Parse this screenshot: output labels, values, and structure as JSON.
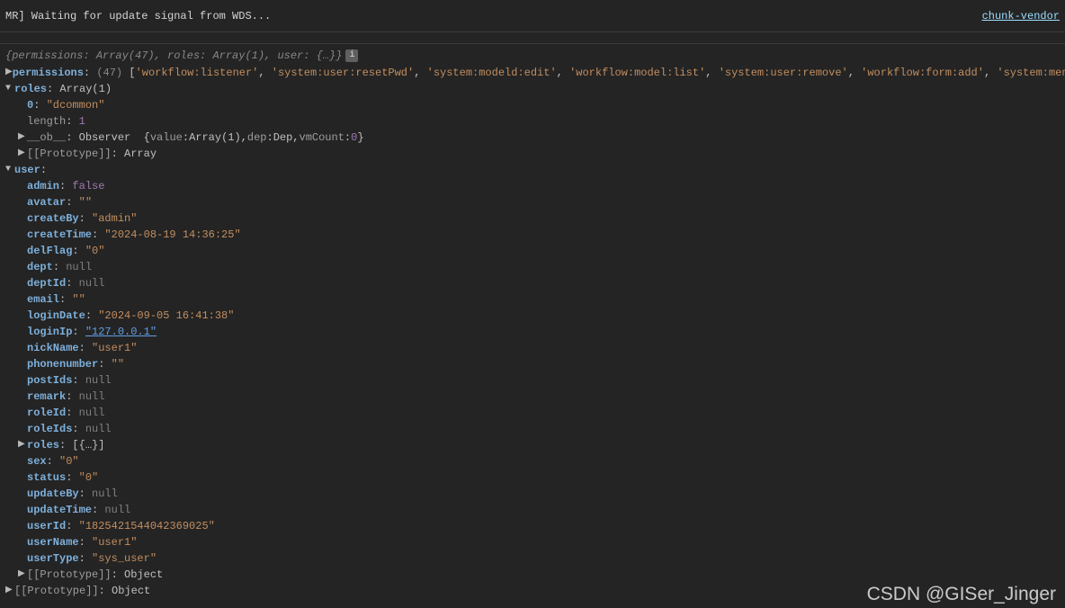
{
  "topbar": {
    "left": "MR] Waiting for update signal from WDS...",
    "right": "chunk-vendor"
  },
  "summary": {
    "text": "{permissions: Array(47), roles: Array(1), user: {…}}",
    "info": "i"
  },
  "permissions": {
    "key": "permissions",
    "count": "(47)",
    "items": [
      "'workflow:listener'",
      "'system:user:resetPwd'",
      "'system:modeld:edit'",
      "'workflow:model:list'",
      "'system:user:remove'",
      "'workflow:form:add'",
      "'system:menu:query'"
    ]
  },
  "roles": {
    "key": "roles",
    "type": "Array(1)",
    "item0": {
      "idx": "0",
      "val": "\"dcommon\""
    },
    "length": {
      "key": "length",
      "val": "1"
    },
    "ob": {
      "key": "__ob__",
      "type": "Observer",
      "preview": "{value: Array(1), dep: Dep, vmCount: 0}"
    },
    "ob_values": {
      "value_key": "value",
      "value_val": "Array(1)",
      "dep_key": "dep",
      "dep_val": "Dep",
      "vm_key": "vmCount",
      "vm_val": "0"
    },
    "proto": {
      "key": "[[Prototype]]",
      "val": "Array"
    }
  },
  "user": {
    "key": "user",
    "props": {
      "admin": {
        "k": "admin",
        "v": "false",
        "t": "bool"
      },
      "avatar": {
        "k": "avatar",
        "v": "\"\"",
        "t": "str"
      },
      "createBy": {
        "k": "createBy",
        "v": "\"admin\"",
        "t": "str"
      },
      "createTime": {
        "k": "createTime",
        "v": "\"2024-08-19 14:36:25\"",
        "t": "str"
      },
      "delFlag": {
        "k": "delFlag",
        "v": "\"0\"",
        "t": "str"
      },
      "dept": {
        "k": "dept",
        "v": "null",
        "t": "null"
      },
      "deptId": {
        "k": "deptId",
        "v": "null",
        "t": "null"
      },
      "email": {
        "k": "email",
        "v": "\"\"",
        "t": "str"
      },
      "loginDate": {
        "k": "loginDate",
        "v": "\"2024-09-05 16:41:38\"",
        "t": "str"
      },
      "loginIp": {
        "k": "loginIp",
        "v": "\"127.0.0.1\"",
        "t": "link"
      },
      "nickName": {
        "k": "nickName",
        "v": "\"user1\"",
        "t": "str"
      },
      "phonenumber": {
        "k": "phonenumber",
        "v": "\"\"",
        "t": "str"
      },
      "postIds": {
        "k": "postIds",
        "v": "null",
        "t": "null"
      },
      "remark": {
        "k": "remark",
        "v": "null",
        "t": "null"
      },
      "roleId": {
        "k": "roleId",
        "v": "null",
        "t": "null"
      },
      "roleIds": {
        "k": "roleIds",
        "v": "null",
        "t": "null"
      },
      "roles": {
        "k": "roles",
        "v": "[{…}]",
        "t": "obj"
      },
      "sex": {
        "k": "sex",
        "v": "\"0\"",
        "t": "str"
      },
      "status": {
        "k": "status",
        "v": "\"0\"",
        "t": "str"
      },
      "updateBy": {
        "k": "updateBy",
        "v": "null",
        "t": "null"
      },
      "updateTime": {
        "k": "updateTime",
        "v": "null",
        "t": "null"
      },
      "userId": {
        "k": "userId",
        "v": "\"1825421544042369025\"",
        "t": "str"
      },
      "userName": {
        "k": "userName",
        "v": "\"user1\"",
        "t": "str"
      },
      "userType": {
        "k": "userType",
        "v": "\"sys_user\"",
        "t": "str"
      }
    },
    "proto": {
      "key": "[[Prototype]]",
      "val": "Object"
    }
  },
  "rootProto": {
    "key": "[[Prototype]]",
    "val": "Object"
  },
  "watermark": "CSDN @GISer_Jinger"
}
